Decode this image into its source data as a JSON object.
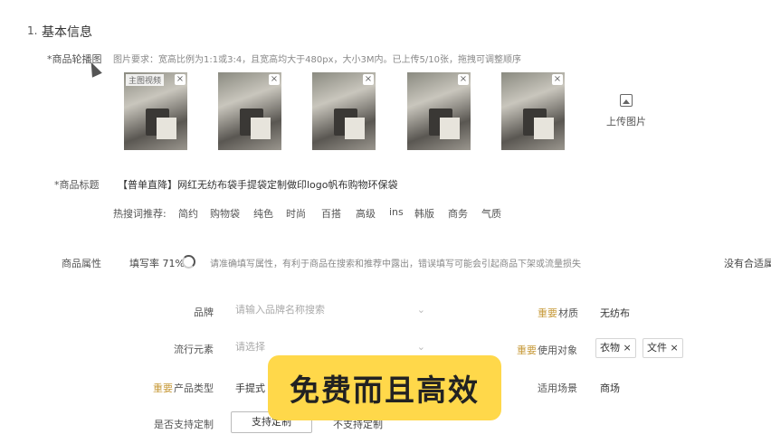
{
  "section": {
    "number": "1.",
    "title": "基本信息"
  },
  "images": {
    "label": "*商品轮播图",
    "requirement": "图片要求：宽高比例为1:1或3:4，且宽高均大于480px，大小3M内。已上传5/10张，拖拽可调整顺序",
    "main_tag": "主图视频",
    "upload_label": "上传图片"
  },
  "title_field": {
    "label": "*商品标题",
    "value": "【普单直降】网红无纺布袋手提袋定制做印logo帆布购物环保袋",
    "hot_label": "热搜词推荐:",
    "keywords": [
      "简约",
      "购物袋",
      "纯色",
      "时尚",
      "百搭",
      "高级",
      "ins",
      "韩版",
      "商务",
      "气质"
    ]
  },
  "attrs": {
    "label": "商品属性",
    "fill_rate_label": "填写率 71%",
    "hint": "请准确填写属性，有利于商品在搜索和推荐中露出，错误填写可能会引起商品下架或流量损失",
    "no_match": "没有合适属"
  },
  "form": {
    "brand_label": "品牌",
    "brand_placeholder": "请输入品牌名称搜索",
    "material_req": "重要",
    "material_label": "材质",
    "material_value": "无纺布",
    "style_label": "流行元素",
    "style_placeholder": "请选择",
    "usage_req": "重要",
    "usage_label": "使用对象",
    "usage_tags": [
      "衣物",
      "文件"
    ],
    "type_req": "重要",
    "type_label": "产品类型",
    "type_value": "手提式",
    "scene_label": "适用场景",
    "scene_value": "商场",
    "custom_label": "是否支持定制",
    "custom_yes": "支持定制",
    "custom_no": "不支持定制"
  },
  "overlay": {
    "text": "免费而且高效",
    "color": "#ffd84a"
  }
}
